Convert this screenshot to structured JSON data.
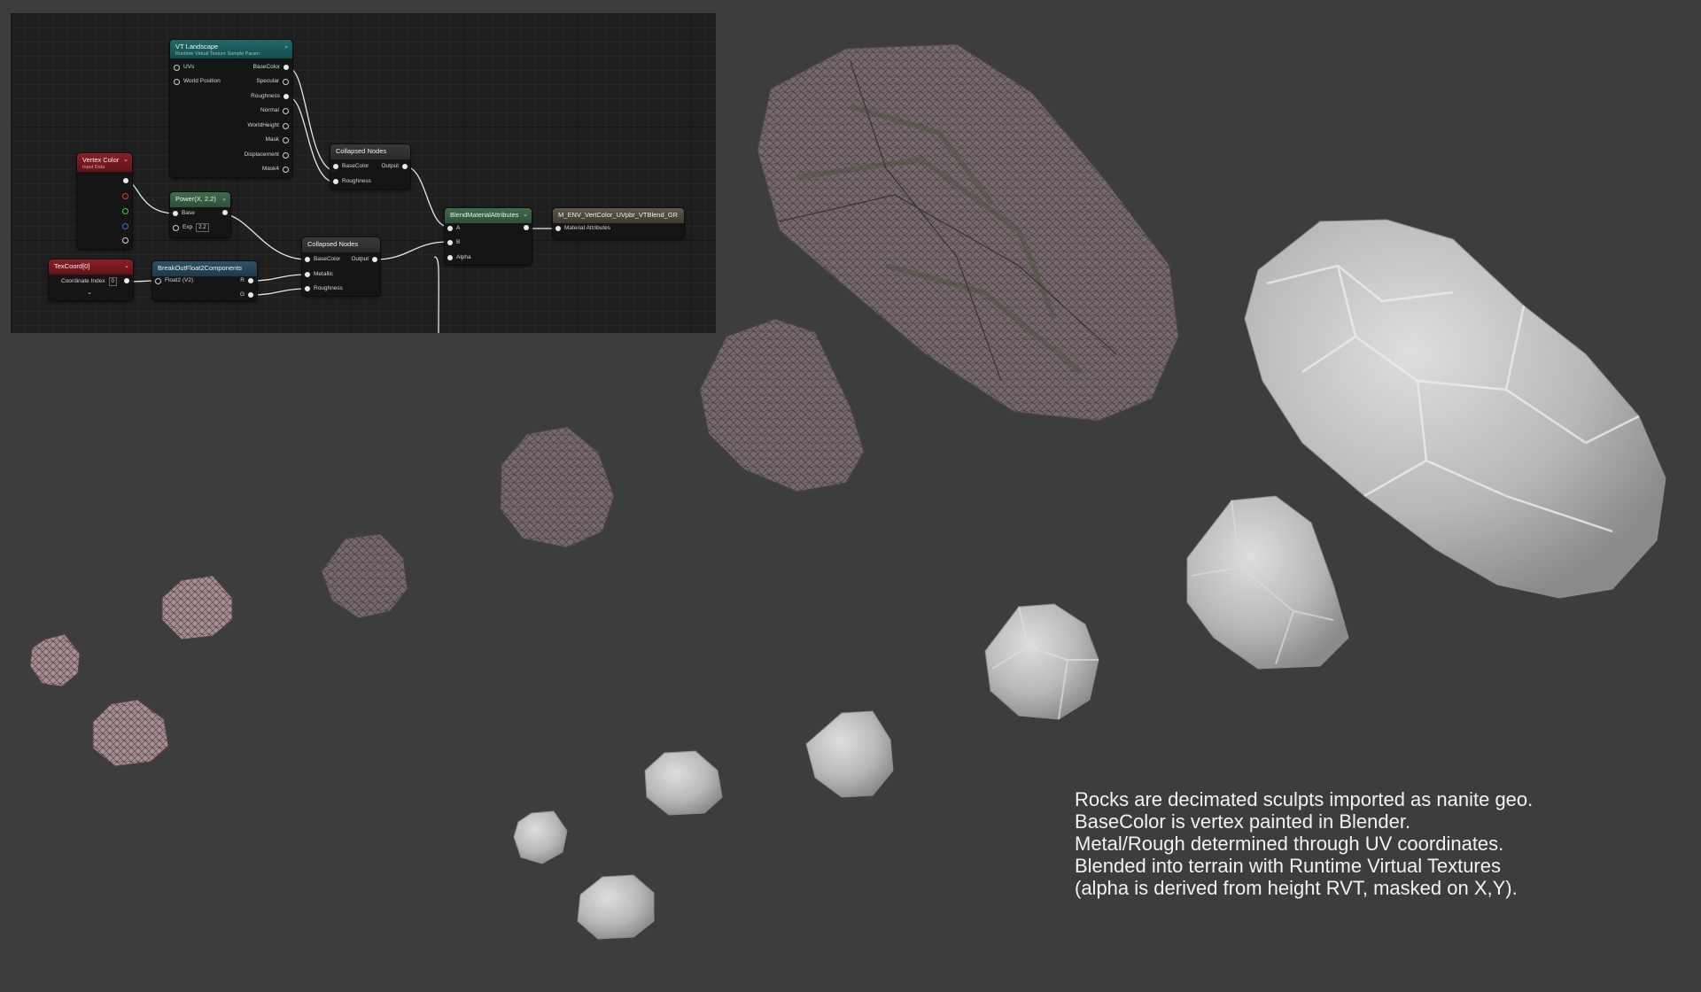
{
  "nodes": {
    "vt_landscape": {
      "title": "VT Landscape",
      "subtitle": "Runtime Virtual Texture Sample Param",
      "inputs": [
        "UVs",
        "World Position"
      ],
      "outputs": [
        "BaseColor",
        "Specular",
        "Roughness",
        "Normal",
        "WorldHeight",
        "Mask",
        "Displacement",
        "Mask4"
      ]
    },
    "vertex_color": {
      "title": "Vertex Color",
      "subtitle": "Input Data"
    },
    "power": {
      "title": "Power(X, 2.2)",
      "base_label": "Base",
      "exp_label": "Exp",
      "exp_value": "2.2"
    },
    "texcoord": {
      "title": "TexCoord[0]",
      "coord_label": "Coordinate Index",
      "coord_value": "0"
    },
    "breakout": {
      "title": "BreakOutFloat2Components",
      "input_label": "Float2 (V2)",
      "out_r": "R",
      "out_g": "G"
    },
    "collapsed_top": {
      "title": "Collapsed Nodes",
      "inputs": [
        "BaseColor",
        "Roughness"
      ],
      "output_label": "Output"
    },
    "collapsed_bottom": {
      "title": "Collapsed Nodes",
      "inputs": [
        "BaseColor",
        "Metallic",
        "Roughness"
      ],
      "output_label": "Output"
    },
    "blend": {
      "title": "BlendMaterialAttributes",
      "inputs": [
        "A",
        "B",
        "Alpha"
      ]
    },
    "material": {
      "title": "M_ENV_VertColor_UVpbr_VTBlend_GR",
      "input_label": "Material Attributes"
    }
  },
  "caption": {
    "line1": "Rocks are decimated sculpts imported as nanite geo.",
    "line2": "BaseColor is vertex painted in Blender.",
    "line3": "Metal/Rough determined through UV coordinates.",
    "line4": "Blended into terrain with Runtime Virtual Textures",
    "line5": "(alpha is derived from height RVT, masked on X,Y)."
  },
  "colors": {
    "background": "#3d3d3d",
    "graph_background": "#1f1f1f",
    "wireframe_rock": "#6e5f63",
    "clay_rock": "#bfbfbf"
  }
}
